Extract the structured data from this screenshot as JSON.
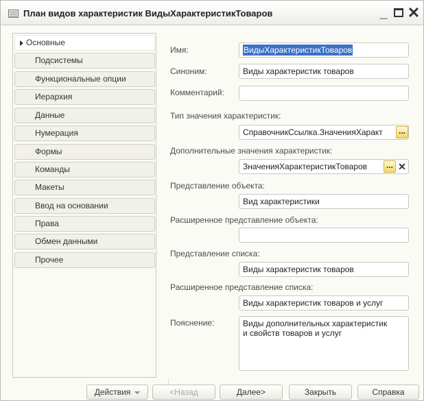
{
  "window": {
    "title": "План видов характеристик ВидыХарактеристикТоваров",
    "minimize": "_",
    "close": "✕"
  },
  "nav": {
    "items": [
      {
        "label": "Основные",
        "active": true
      },
      {
        "label": "Подсистемы"
      },
      {
        "label": "Функциональные опции"
      },
      {
        "label": "Иерархия"
      },
      {
        "label": "Данные"
      },
      {
        "label": "Нумерация"
      },
      {
        "label": "Формы"
      },
      {
        "label": "Команды"
      },
      {
        "label": "Макеты"
      },
      {
        "label": "Ввод на основании"
      },
      {
        "label": "Права"
      },
      {
        "label": "Обмен данными"
      },
      {
        "label": "Прочее"
      }
    ]
  },
  "form": {
    "name_label": "Имя:",
    "name_value": "ВидыХарактеристикТоваров",
    "synonym_label": "Синоним:",
    "synonym_value": "Виды характеристик товаров",
    "comment_label": "Комментарий:",
    "comment_value": "",
    "value_type_label": "Тип значения характеристик:",
    "value_type_value": "СправочникСсылка.ЗначенияХаракт",
    "extra_values_label": "Дополнительные значения характеристик:",
    "extra_values_value": "ЗначенияХарактеристикТоваров",
    "object_repr_label": "Представление объекта:",
    "object_repr_value": "Вид характеристики",
    "ext_object_repr_label": "Расширенное представление объекта:",
    "ext_object_repr_value": "",
    "list_repr_label": "Представление списка:",
    "list_repr_value": "Виды характеристик товаров",
    "ext_list_repr_label": "Расширенное представление списка:",
    "ext_list_repr_value": "Виды характеристик товаров и услуг",
    "explanation_label": "Пояснение:",
    "explanation_value": "Виды дополнительных характеристик\nи свойств товаров и услуг",
    "choose_btn": "...",
    "clear_btn": "✕"
  },
  "buttons": {
    "actions": "Действия",
    "back": "<Назад",
    "next": "Далее>",
    "close": "Закрыть",
    "help": "Справка"
  }
}
